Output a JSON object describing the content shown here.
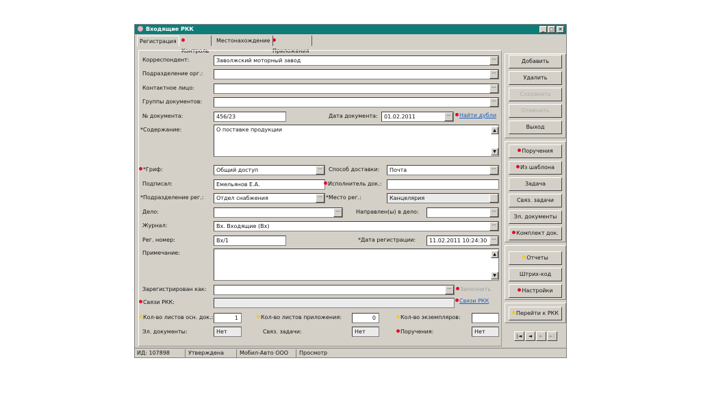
{
  "window": {
    "title": "Входящие РКК",
    "minimize": "_",
    "maximize": "□",
    "close": "✕"
  },
  "tabs": [
    "Регистрация",
    "Контроль",
    "Местонахождение",
    "Приложения"
  ],
  "form": {
    "correspondent": {
      "label": "Корреспондент:",
      "value": "Заволжский моторный завод"
    },
    "org_unit": {
      "label": "Подразделение орг.:",
      "value": ""
    },
    "contact": {
      "label": "Контактное лицо:",
      "value": ""
    },
    "doc_groups": {
      "label": "Группы документов:",
      "value": ""
    },
    "doc_number": {
      "label": "№ документа:",
      "value": "456/23"
    },
    "doc_date": {
      "label": "Дата документа:",
      "value": "01.02.2011"
    },
    "find_duplicates": "Найти дубли",
    "content": {
      "label": "*Содержание:",
      "value": "О поставке продукции"
    },
    "grif": {
      "label": "*Гриф:",
      "value": "Общий доступ"
    },
    "delivery": {
      "label": "Способ доставки:",
      "value": "Почта"
    },
    "signed": {
      "label": "Подписал:",
      "value": "Емельянов Е.А."
    },
    "executor": {
      "label": "Исполнитель док.:",
      "value": ""
    },
    "reg_unit": {
      "label": "*Подразделение рег.:",
      "value": "Отдел снабжения"
    },
    "reg_place": {
      "label": "*Место рег.:",
      "value": "Канцелярия"
    },
    "case": {
      "label": "Дело:",
      "value": ""
    },
    "sent_to_case": {
      "label": "Направлен(ы) в дело:",
      "value": ""
    },
    "journal": {
      "label": "Журнал:",
      "value": "Вх. Входящие (Вх)"
    },
    "reg_number": {
      "label": "Рег. номер:",
      "value": "Вх/1"
    },
    "reg_date": {
      "label": "*Дата регистрации:",
      "value": "11.02.2011 10:24:30"
    },
    "note": {
      "label": "Примечание:",
      "value": ""
    },
    "registered_as": {
      "label": "Зарегистрирован как:",
      "value": ""
    },
    "fill_link": "Заполнить",
    "rkk_links": {
      "label": "Связи РКК:",
      "value": ""
    },
    "rkk_links_link": "Связи РКК",
    "sheets_main": {
      "label": "Кол-во листов осн. док.:",
      "value": "1"
    },
    "sheets_attach": {
      "label": "Кол-во листов приложения:",
      "value": "0"
    },
    "copies": {
      "label": "Кол-во экземпляров:",
      "value": ""
    },
    "el_docs": {
      "label": "Эл. документы:",
      "value": "Нет"
    },
    "linked_tasks": {
      "label": "Связ. задачи:",
      "value": "Нет"
    },
    "assignments": {
      "label": "Поручения:",
      "value": "Нет"
    }
  },
  "buttons": {
    "add": "Добавить",
    "delete": "Удалить",
    "save": "Сохранить",
    "cancel": "Отменить",
    "exit": "Выход",
    "assignments": "Поручения",
    "from_template": "Из шаблона",
    "task": "Задача",
    "linked_tasks": "Связ. задачи",
    "el_docs": "Эл. документы",
    "doc_set": "Комплект док.",
    "reports": "Отчеты",
    "barcode": "Штрих-код",
    "settings": "Настройки",
    "goto_rkk": "Перейти к РКК"
  },
  "nav": {
    "first": "|◄",
    "prev": "◄",
    "next": "►",
    "last": "►|"
  },
  "status": {
    "id": "ИД: 107898",
    "state": "Утверждена",
    "org": "Мобил-Авто ООО",
    "mode": "Просмотр"
  },
  "colors": {
    "title_bar": "#0e7d7a",
    "required_marker": "#e0102a",
    "optional_marker": "#f2c830",
    "link": "#1a5fc0"
  }
}
